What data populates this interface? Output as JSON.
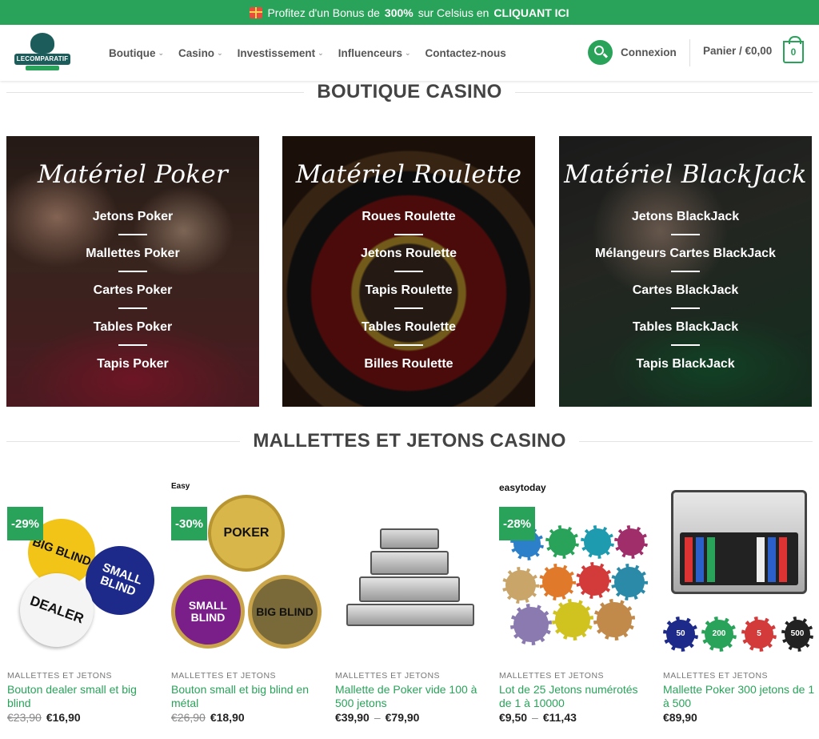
{
  "promo": {
    "text_before": "Profitez d'un Bonus de",
    "percent": "300%",
    "text_mid": "sur Celsius en",
    "cta": "CLIQUANT ICI"
  },
  "header": {
    "logo_text": "LECOMPARATIF",
    "nav": [
      {
        "label": "Boutique",
        "has_dropdown": true
      },
      {
        "label": "Casino",
        "has_dropdown": true
      },
      {
        "label": "Investissement",
        "has_dropdown": true
      },
      {
        "label": "Influenceurs",
        "has_dropdown": true
      },
      {
        "label": "Contactez-nous",
        "has_dropdown": false
      }
    ],
    "login": "Connexion",
    "cart_label": "Panier / €0,00",
    "cart_count": "0",
    "accent_color": "#2aa35a"
  },
  "sections": {
    "boutique_title": "BOUTIQUE CASINO",
    "mallettes_title": "MALLETTES ET JETONS CASINO"
  },
  "categories": [
    {
      "title": "Matériel Poker",
      "links": [
        "Jetons Poker",
        "Mallettes Poker",
        "Cartes Poker",
        "Tables Poker",
        "Tapis Poker"
      ]
    },
    {
      "title": "Matériel Roulette",
      "links": [
        "Roues Roulette",
        "Jetons Roulette",
        "Tapis Roulette",
        "Tables Roulette",
        "Billes Roulette"
      ]
    },
    {
      "title": "Matériel BlackJack",
      "links": [
        "Jetons BlackJack",
        "Mélangeurs Cartes BlackJack",
        "Cartes BlackJack",
        "Tables BlackJack",
        "Tapis BlackJack"
      ]
    }
  ],
  "products": [
    {
      "badge": "-29%",
      "category": "MALLETTES ET JETONS",
      "name": "Bouton dealer small et big blind",
      "old_price": "€23,90",
      "price": "€16,90",
      "img_labels": [
        "BIG BLIND",
        "SMALL BLIND",
        "DEALER"
      ]
    },
    {
      "badge": "-30%",
      "brand": "Easy",
      "category": "MALLETTES ET JETONS",
      "name": "Bouton small et big blind en métal",
      "old_price": "€26,90",
      "price": "€18,90",
      "img_labels": [
        "POKER",
        "SMALL BLIND",
        "BIG BLIND"
      ]
    },
    {
      "category": "MALLETTES ET JETONS",
      "name": "Mallette de Poker vide 100 à 500 jetons",
      "price_min": "€39,90",
      "price_max": "€79,90"
    },
    {
      "badge": "-28%",
      "brand": "easytoday",
      "category": "MALLETTES ET JETONS",
      "name": "Lot de 25 Jetons numérotés de 1 à 10000",
      "price_min": "€9,50",
      "price_max": "€11,43"
    },
    {
      "category": "MALLETTES ET JETONS",
      "name": "Mallette Poker 300 jetons de 1 à 500",
      "price": "€89,90",
      "img_labels": [
        "50",
        "200",
        "5",
        "500"
      ]
    }
  ]
}
